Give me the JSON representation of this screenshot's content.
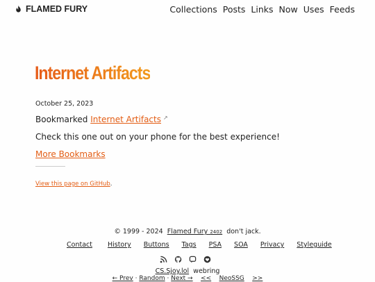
{
  "header": {
    "brand": "FLAMED FURY",
    "nav": [
      "Collections",
      "Posts",
      "Links",
      "Now",
      "Uses",
      "Feeds"
    ]
  },
  "post": {
    "title": "Internet Artifacts",
    "date": "October 25, 2023",
    "bookmarked_prefix": "Bookmarked",
    "bookmark_link": "Internet Artifacts",
    "external_mark": "↗",
    "note": "Check this one out on your phone for the best experience!",
    "more": "More Bookmarks",
    "github": "View this page on GitHub",
    "github_suffix": "."
  },
  "footer": {
    "copyright": "© 1999 - 2024",
    "site": "Flamed Fury",
    "build": "2402",
    "tagline": "don't jack.",
    "links": [
      "Contact",
      "History",
      "Buttons",
      "Tags",
      "PSA",
      "SOA",
      "Privacy",
      "Styleguide"
    ],
    "webring_name": "CS.Sjoy.lol",
    "webring_label": "webring",
    "prev": "← Prev",
    "random": "Random",
    "next": "Next →",
    "ring_prev": "<<",
    "ring_name": "NeoSSG",
    "ring_next": ">>",
    "sep": "·"
  },
  "icons": [
    "rss-icon",
    "github-icon",
    "mastodon-icon",
    "heart-badge-icon"
  ],
  "colors": {
    "accent": "#e35d14",
    "title_start": "#e65c1a",
    "title_end": "#f29a1c"
  }
}
